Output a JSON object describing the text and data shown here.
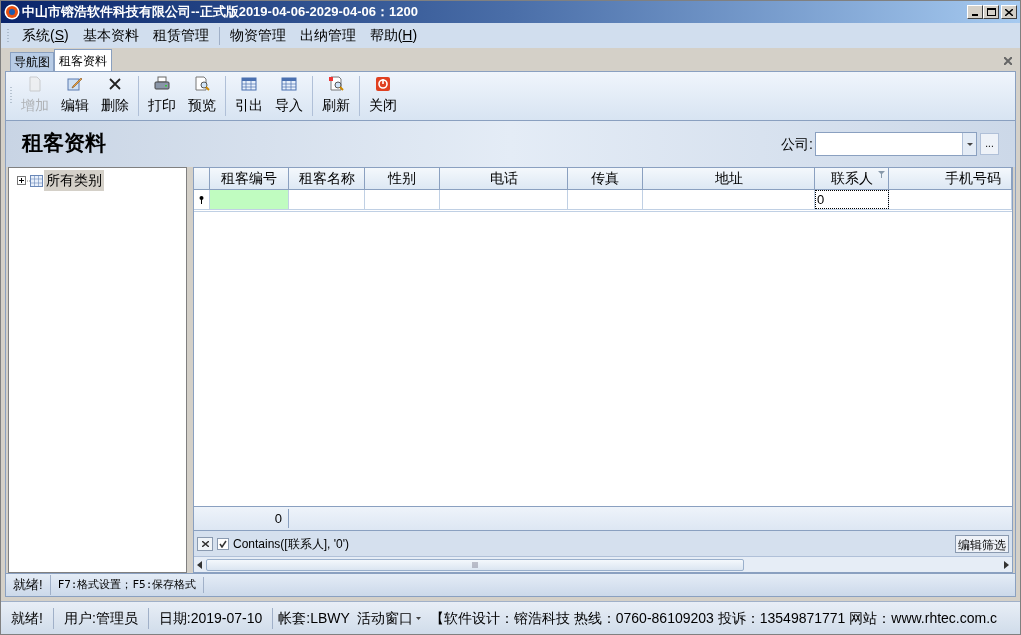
{
  "window": {
    "title": "中山市镕浩软件科技有限公司--正式版2019-04-06-2029-04-06：1200"
  },
  "menu": [
    {
      "items": [
        {
          "before": "系统(",
          "key": "S",
          "after": ")"
        },
        {
          "before": "基本资料"
        },
        {
          "before": "租赁管理"
        }
      ]
    },
    {
      "items": [
        {
          "before": "物资管理"
        },
        {
          "before": "出纳管理"
        },
        {
          "before": "帮助(",
          "key": "H",
          "after": ")"
        }
      ]
    }
  ],
  "tabs": [
    {
      "label": "导航图",
      "selected": false
    },
    {
      "label": "租客资料",
      "selected": true
    }
  ],
  "toolbar": [
    {
      "items": [
        {
          "kind": "new",
          "label": "增加",
          "disabled": true
        },
        {
          "kind": "edit",
          "label": "编辑",
          "disabled": false
        },
        {
          "kind": "delete",
          "label": "删除",
          "disabled": false
        }
      ]
    },
    {
      "items": [
        {
          "kind": "print",
          "label": "打印",
          "disabled": false
        },
        {
          "kind": "preview",
          "label": "预览",
          "disabled": false
        }
      ]
    },
    {
      "items": [
        {
          "kind": "grid",
          "label": "引出",
          "disabled": false
        },
        {
          "kind": "grid",
          "label": "导入",
          "disabled": false
        }
      ]
    },
    {
      "items": [
        {
          "kind": "refresh",
          "label": "刷新",
          "disabled": false
        }
      ]
    },
    {
      "items": [
        {
          "kind": "close",
          "label": "关闭",
          "disabled": false
        }
      ]
    }
  ],
  "header": {
    "title": "租客资料",
    "company_label": "公司:",
    "company_button": "..."
  },
  "tree": [
    {
      "label": "所有类别",
      "expanded": false,
      "selected": true
    }
  ],
  "table": {
    "columns": [
      {
        "label": "租客编号",
        "filtered": false
      },
      {
        "label": "租客名称",
        "filtered": false
      },
      {
        "label": "性别",
        "filtered": false
      },
      {
        "label": "电话",
        "filtered": false
      },
      {
        "label": "传真",
        "filtered": false
      },
      {
        "label": "地址",
        "filtered": false
      },
      {
        "label": "联系人",
        "filtered": true
      },
      {
        "label": "手机号码",
        "filtered": false
      }
    ],
    "new_row": [
      {
        "highlighted": true,
        "focused": false
      },
      {
        "highlighted": false,
        "focused": false
      },
      {
        "highlighted": false,
        "focused": false
      },
      {
        "highlighted": false,
        "focused": false
      },
      {
        "highlighted": false,
        "focused": false
      },
      {
        "highlighted": false,
        "focused": false
      },
      {
        "highlighted": false,
        "focused": true,
        "value": "0"
      },
      {
        "highlighted": false,
        "focused": false
      }
    ],
    "summary": "0",
    "filter": {
      "checked": true,
      "text": "Contains([联系人], '0')",
      "edit_button": "编辑筛选"
    }
  },
  "inner_status": [
    "就绪!",
    "F7:格式设置；F5:保存格式"
  ],
  "status_bar": [
    {
      "kind": "text",
      "text": "就绪!"
    },
    {
      "kind": "text",
      "text": "用户:管理员"
    },
    {
      "kind": "text",
      "text": "日期:2019-07-10"
    },
    {
      "kind": "plain",
      "text": "帐套:LBWY"
    },
    {
      "kind": "dropdown",
      "text": "活动窗口"
    },
    {
      "kind": "plain",
      "text": "【软件设计：镕浩科技 热线：0760-86109203 投诉：13549871771 网站：www.rhtec.com.c"
    }
  ]
}
